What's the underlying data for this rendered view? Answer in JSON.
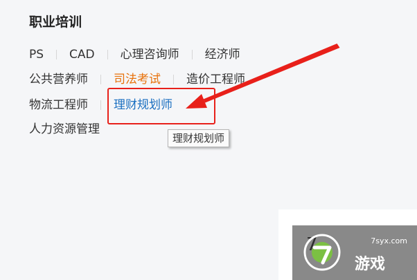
{
  "section": {
    "title": "职业培训"
  },
  "links": {
    "row1": [
      "PS",
      "CAD",
      "心理咨询师",
      "经济师"
    ],
    "row2": [
      "公共营养师",
      "司法考试",
      "造价工程师"
    ],
    "row3": [
      "物流工程师",
      "理财规划师"
    ],
    "row4": [
      "人力资源管理"
    ]
  },
  "tooltip": {
    "text": "理财规划师"
  },
  "card": {
    "number": "7"
  },
  "watermark": {
    "url": "7syx.com",
    "brand": "游戏"
  },
  "colors": {
    "hover_link": "#1a6fc0",
    "active_link": "#e8710a",
    "annotation": "#e8201a"
  }
}
